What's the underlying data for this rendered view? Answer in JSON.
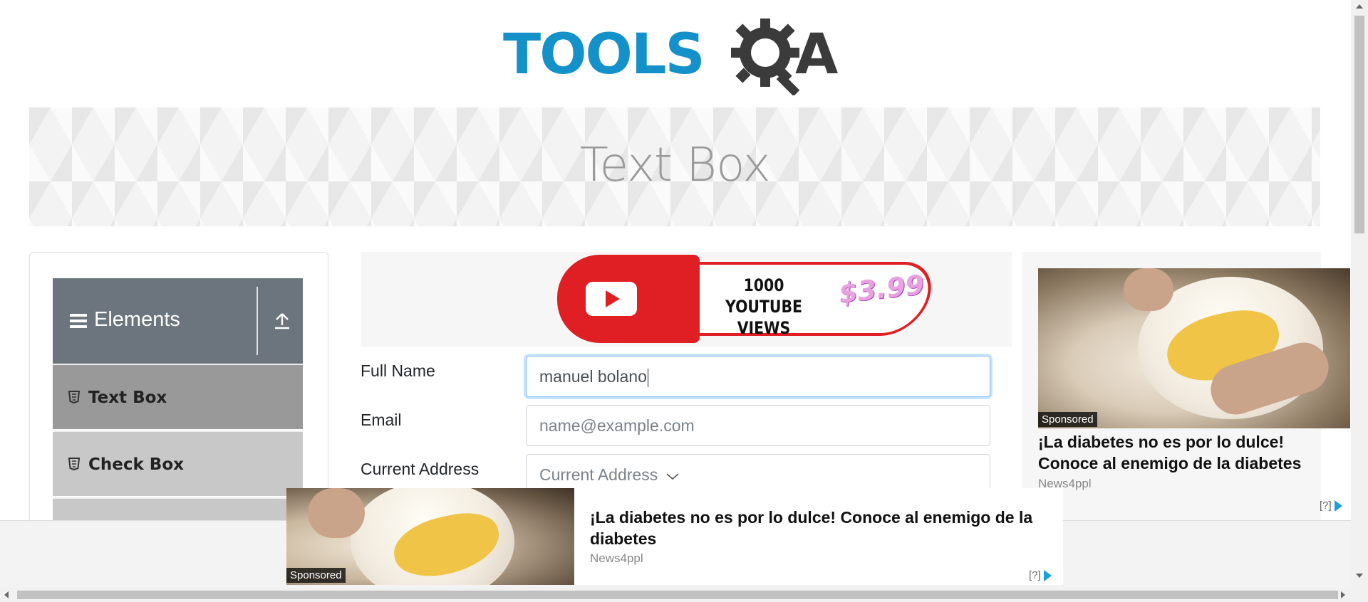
{
  "header": {
    "logo_text_left": "TOOLS",
    "logo_text_right": "A"
  },
  "banner": {
    "title": "Text Box"
  },
  "sidebar": {
    "group_title": "Elements",
    "items": [
      {
        "label": "Text Box",
        "icon": "html5-icon",
        "active": true
      },
      {
        "label": "Check Box",
        "icon": "html5-icon",
        "active": false
      }
    ]
  },
  "form_ad": {
    "views_line1": "1000",
    "views_line2": "YOUTUBE VIEWS",
    "price": "$3.99"
  },
  "form": {
    "full_name": {
      "label": "Full Name",
      "value": "manuel bolano"
    },
    "email": {
      "label": "Email",
      "placeholder": "name@example.com"
    },
    "current_address": {
      "label": "Current Address",
      "placeholder": "Current Address"
    }
  },
  "right_ad": {
    "badge": "Sponsored",
    "title": "¡La diabetes no es por lo dulce! Conoce al enemigo de la diabetes",
    "source": "News4ppl",
    "adchoice": "[?]"
  },
  "bottom_ad": {
    "badge": "Sponsored",
    "title": "¡La diabetes no es por lo dulce! Conoce al enemigo de la diabetes",
    "source": "News4ppl",
    "adchoice": "[?]"
  },
  "colors": {
    "logo_blue": "#1591c9",
    "logo_dark": "#3b3b3b",
    "sidebar_header": "#6c757d",
    "focus_border": "#80bdff",
    "ad_red": "#e01f25"
  }
}
